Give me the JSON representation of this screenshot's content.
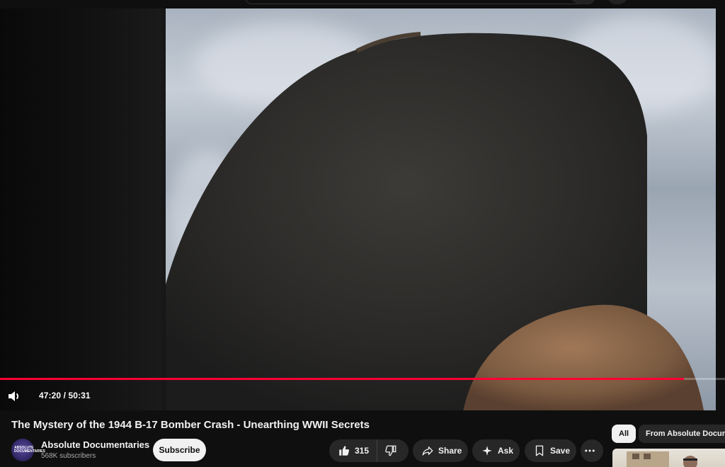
{
  "player": {
    "progress_fraction": 0.943,
    "time_current": "47:20",
    "time_separator": " / ",
    "time_total": "50:31",
    "accent_color": "#ff0033"
  },
  "video": {
    "title": "The Mystery of the 1944 B-17 Bomber Crash - Unearthing WWII Secrets"
  },
  "channel": {
    "name": "Absolute Documentaries",
    "subscribers": "568K subscribers",
    "avatar_text": "ABSOLUTE DOCUMENTARIES",
    "subscribe_label": "Subscribe"
  },
  "actions": {
    "like_count": "315",
    "share_label": "Share",
    "ask_label": "Ask",
    "save_label": "Save"
  },
  "chips": {
    "all": "All",
    "from_channel": "From Absolute Documentaries"
  },
  "icons": {
    "volume": "volume-icon",
    "like": "thumbs-up-icon",
    "dislike": "thumbs-down-icon",
    "share": "share-icon",
    "ask": "sparkle-icon",
    "save": "bookmark-icon",
    "more": "more-horiz-icon"
  }
}
